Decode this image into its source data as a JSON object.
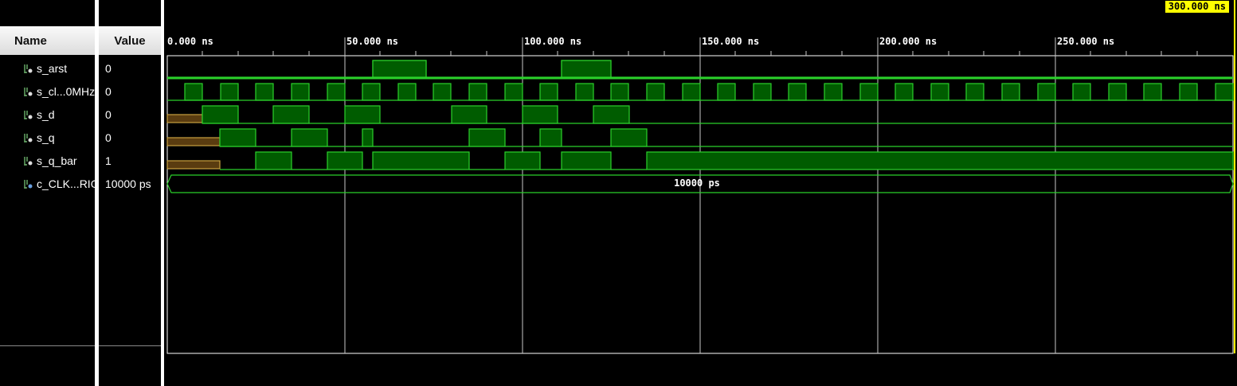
{
  "header": {
    "name_label": "Name",
    "value_label": "Value"
  },
  "cursor": {
    "label": "300.000 ns"
  },
  "timeline": {
    "ticks": [
      "0.000 ns",
      "50.000 ns",
      "100.000 ns",
      "150.000 ns",
      "200.000 ns",
      "250.000 ns"
    ]
  },
  "signals": [
    {
      "name": "s_arst",
      "value": "0",
      "icon": "signal-icon"
    },
    {
      "name": "s_cl...0MHz",
      "value": "0",
      "icon": "signal-icon"
    },
    {
      "name": "s_d",
      "value": "0",
      "icon": "signal-icon"
    },
    {
      "name": "s_q",
      "value": "0",
      "icon": "signal-icon"
    },
    {
      "name": "s_q_bar",
      "value": "1",
      "icon": "signal-icon"
    },
    {
      "name": "c_CLK...RIOD",
      "value": "10000 ps",
      "icon": "constant-icon"
    }
  ],
  "bus_value": "10000 ps",
  "colors": {
    "wave": "#2bd02b",
    "wave_fill": "#005c00",
    "uninit": "#c8a040",
    "uninit_fill": "#5a3c10",
    "cursor": "#ffff00"
  }
}
